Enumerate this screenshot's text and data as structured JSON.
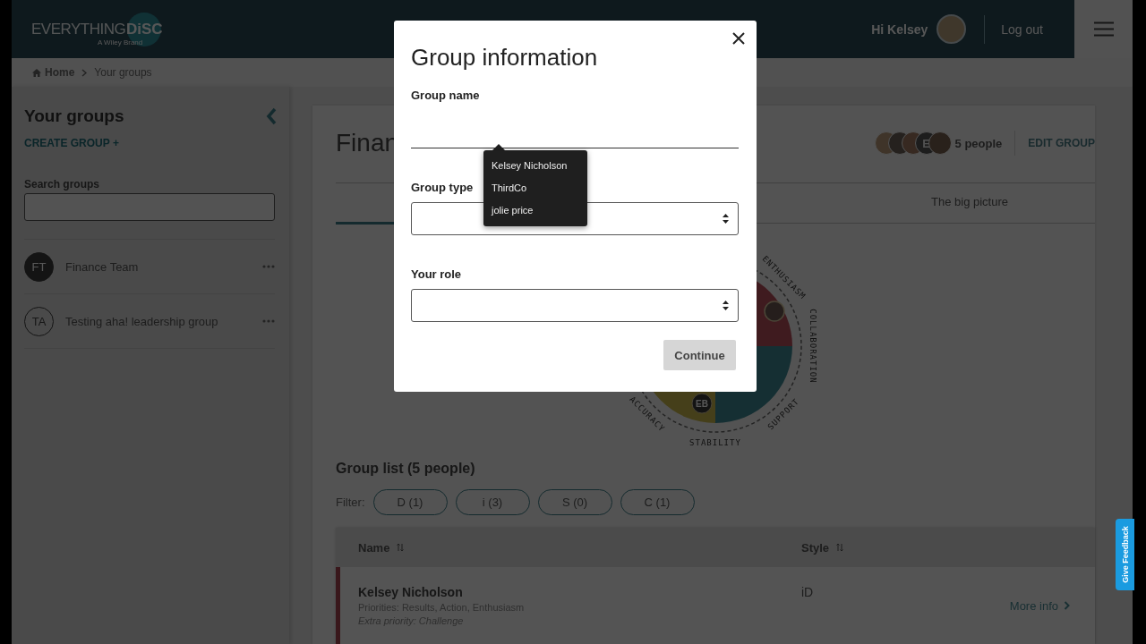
{
  "header": {
    "logo": "EVERYTHING",
    "logo_badge": "DiSC",
    "logo_tagline": "A Wiley Brand",
    "greeting": "Hi Kelsey",
    "logout": "Log out"
  },
  "breadcrumb": [
    {
      "label": "Home"
    },
    {
      "label": "Your groups"
    }
  ],
  "sidebar": {
    "title": "Your groups",
    "create": "CREATE GROUP +",
    "search_label": "Search groups",
    "groups": [
      {
        "initials": "FT",
        "name": "Finance Team",
        "selected": true
      },
      {
        "initials": "TA",
        "name": "Testing aha! leadership group",
        "selected": false
      }
    ]
  },
  "group": {
    "title": "Finan",
    "people": "5 people",
    "edit": "EDIT GROUP",
    "members": [
      {
        "kind": "photo"
      },
      {
        "kind": "photo"
      },
      {
        "kind": "photo"
      },
      {
        "kind": "initial",
        "initial": "E"
      },
      {
        "kind": "photo"
      }
    ]
  },
  "tabs": [
    {
      "label": "The big picture",
      "selected": false
    }
  ],
  "disc_map": {
    "labels": [
      "ENTHUSIASM",
      "COLLABORATION",
      "SUPPORT",
      "STABILITY",
      "ACCURACY"
    ],
    "markers": [
      {
        "kind": "photo"
      },
      {
        "kind": "initials",
        "initials": "EB"
      }
    ]
  },
  "group_list": {
    "title": "Group list (5 people)",
    "filter_label": "Filter:",
    "filters": [
      {
        "label": "D (1)",
        "selected": false
      },
      {
        "label": "i (3)",
        "selected": false
      },
      {
        "label": "S (0)",
        "selected": false
      },
      {
        "label": "C (1)",
        "selected": false
      }
    ],
    "columns": [
      "Name",
      "Style"
    ],
    "rows": [
      {
        "name": "Kelsey Nicholson",
        "priorities": "Priorities: Results, Action, Enthusiasm",
        "extra": "Extra priority: Challenge",
        "style": "iD",
        "more": "More info"
      }
    ]
  },
  "modal": {
    "title": "Group information",
    "fields": [
      {
        "kind": "text",
        "label": "Group name"
      },
      {
        "kind": "select",
        "label": "Group type"
      },
      {
        "kind": "select",
        "label": "Your role"
      }
    ],
    "suggestions": [
      "Kelsey Nicholson",
      "ThirdCo",
      "jolie price"
    ],
    "submit": "Continue"
  },
  "feedback": "Give Feedback"
}
